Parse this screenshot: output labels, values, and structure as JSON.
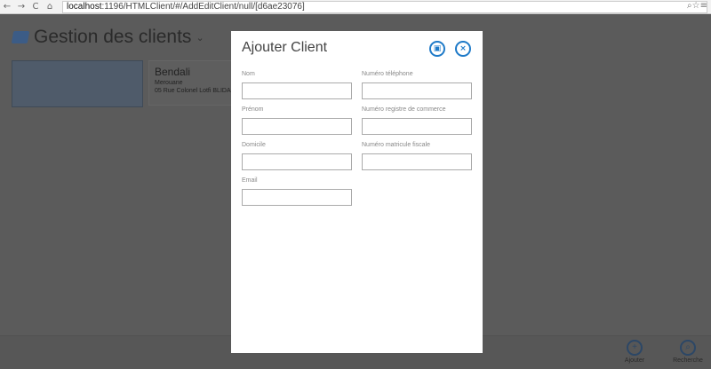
{
  "browser": {
    "url_host": "localhost",
    "url_rest": ":1196/HTMLClient/#/AddEditClient/null/[d6ae23076]"
  },
  "app": {
    "title": "Gestion des clients"
  },
  "client_card": {
    "name": "Bendali",
    "first_name": "Merouane",
    "address": "05 Rue Colonel Lotfi BLIDA"
  },
  "modal": {
    "title": "Ajouter Client",
    "fields": [
      {
        "label": "Nom",
        "value": ""
      },
      {
        "label": "Numéro téléphone",
        "value": ""
      },
      {
        "label": "Prénom",
        "value": ""
      },
      {
        "label": "Numéro registre de commerce",
        "value": ""
      },
      {
        "label": "Domicile",
        "value": ""
      },
      {
        "label": "Numéro matricule fiscale",
        "value": ""
      },
      {
        "label": "Email",
        "value": ""
      }
    ]
  },
  "footer": {
    "add_label": "Ajouter",
    "search_label": "Recherche"
  }
}
